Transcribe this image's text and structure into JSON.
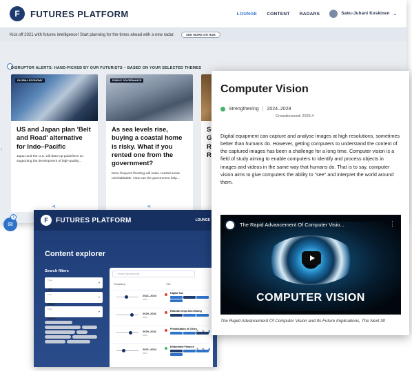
{
  "dashboard": {
    "brand": "FUTURES PLATFORM",
    "nav": [
      "LOUNGE",
      "CONTENT",
      "RADARS"
    ],
    "user_name": "Saku-Juhani Koskinen",
    "banner_text": "Kick off 2021 with futures intelligence! Start planning for the times ahead with a new radar.",
    "banner_button": "SEE MORE ON HUB",
    "alerts_heading": "DISRUPTOR ALERTS: HAND-PICKED BY OUR FUTURISTS – BASED ON YOUR SELECTED THEMES",
    "mail_count": "3",
    "cards": [
      {
        "tag": "GLOBAL ECONOMY",
        "title": "US and Japan plan 'Belt and Road' alternative for Indo–Pacific",
        "desc": "Japan and the U.S. will draw up guidelines on supporting the development of high-quality..."
      },
      {
        "tag": "PUBLIC GOVERNANCE",
        "title": "As sea levels rise, buying a coastal home is risky. What if you rented one from the government?",
        "desc": "More frequent flooding will make coastal areas uninhabitable. How can the government help..."
      },
      {
        "tag": "",
        "title": "Sc G Ri Re",
        "desc": ""
      }
    ],
    "icons": {
      "share": "share-icon",
      "mail": "mail-icon",
      "arrow": "chevron-left-icon"
    }
  },
  "explorer": {
    "brand": "FUTURES PLATFORM",
    "nav": "LOUNGE",
    "title": "Content explorer",
    "filters_title": "Search filters",
    "filters": [
      {
        "label": "Type",
        "value": "All"
      },
      {
        "label": "Time",
        "value": "2021 –"
      },
      {
        "label": "Pace",
        "value": "None"
      }
    ],
    "search_placeholder": "Search by keywords",
    "columns": [
      "Timestamp",
      "Title"
    ],
    "rows": [
      {
        "years": "2021–2024",
        "crowd": "2023",
        "name": "Digital Tax",
        "status_color": "#e0443b"
      },
      {
        "years": "2029–2041",
        "crowd": "2036",
        "name": "Robotic Deep-Sea Mining",
        "status_color": "#e0443b"
      },
      {
        "years": "2029–2041",
        "crowd": "2033",
        "name": "Privatisation of Cities",
        "status_color": "#e0443b"
      },
      {
        "years": "2021–2024",
        "crowd": "2024",
        "name": "Embedded Finance",
        "status_color": "#49b36b"
      }
    ]
  },
  "article": {
    "title": "Computer Vision",
    "status": "Strengthening",
    "status_color": "#49b36b",
    "separator": "|",
    "years": "2024–2028",
    "crowdsourced": "Crowdsourced: 2025.4",
    "body": "Digital equipment can capture and analyse images at high resolutions, sometimes better than humans do. However, getting computers to understand the content of the captured images has been a challenge for a long time. Computer vision is a field of study aiming to enable computers to identify and process objects in images and videos in the same way that humans do. That is to say, computer vision aims to give computers the ability to \"see\" and interpret the world around them.",
    "video_title": "The Rapid Advancement Of Computer Visio...",
    "video_overlay": "COMPUTER VISION",
    "video_caption": "The Rapid Advancement Of Computer Vision and Its Future Implications, The Next 30",
    "icons": {
      "play": "play-icon",
      "menu": "kebab-menu-icon"
    }
  }
}
